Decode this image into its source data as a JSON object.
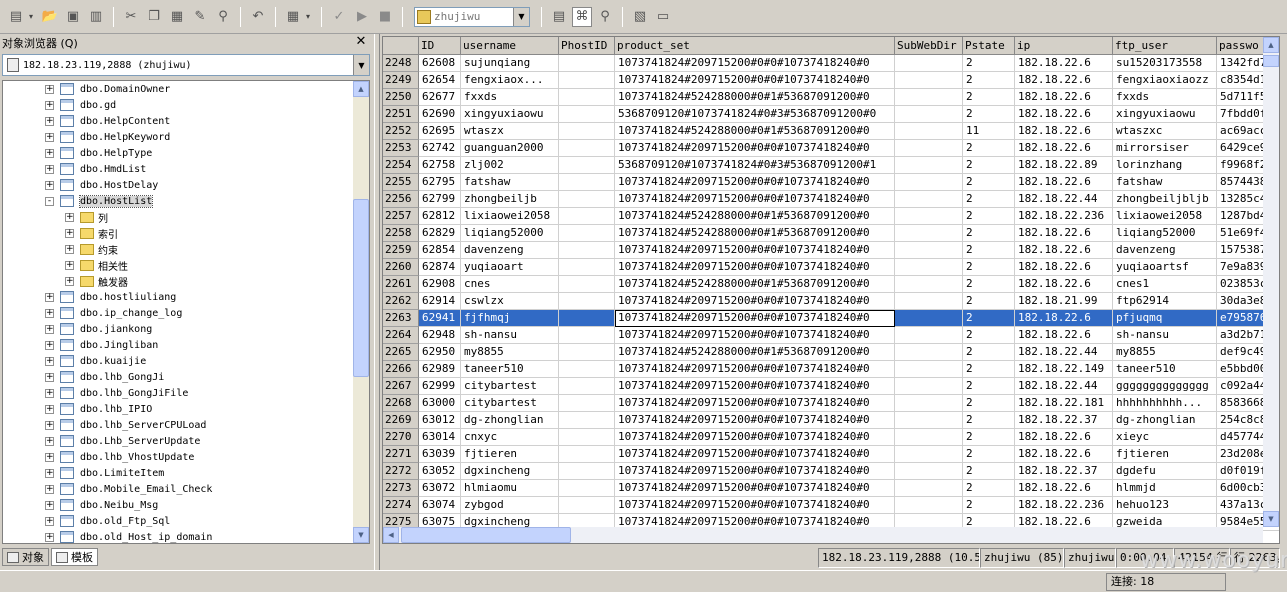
{
  "toolbar": {
    "db_value": "zhujiwu",
    "icons": [
      "new-query-icon",
      "open-icon",
      "save-icon",
      "save-all-icon",
      "cut-icon",
      "copy-icon",
      "paste-icon",
      "edit-icon",
      "find-icon",
      "undo-icon",
      "grid-icon",
      "check-icon",
      "execute-icon",
      "stop-icon",
      "database-icon",
      "results-pane-icon",
      "object-browser-icon",
      "object-search-icon",
      "properties-icon",
      "show-results-icon"
    ]
  },
  "left_pane": {
    "title": "对象浏览器 (Q)",
    "server": "182.18.23.119,2888 (zhujiwu)",
    "tree": [
      {
        "label": "dbo.DomainOwner",
        "type": "table",
        "level": 0,
        "exp": "+"
      },
      {
        "label": "dbo.gd",
        "type": "table",
        "level": 0,
        "exp": "+"
      },
      {
        "label": "dbo.HelpContent",
        "type": "table",
        "level": 0,
        "exp": "+"
      },
      {
        "label": "dbo.HelpKeyword",
        "type": "table",
        "level": 0,
        "exp": "+"
      },
      {
        "label": "dbo.HelpType",
        "type": "table",
        "level": 0,
        "exp": "+"
      },
      {
        "label": "dbo.HmdList",
        "type": "table",
        "level": 0,
        "exp": "+"
      },
      {
        "label": "dbo.HostDelay",
        "type": "table",
        "level": 0,
        "exp": "+"
      },
      {
        "label": "dbo.HostList",
        "type": "table",
        "level": 0,
        "exp": "-",
        "selected": true
      },
      {
        "label": "列",
        "type": "folder",
        "level": 1,
        "exp": "+"
      },
      {
        "label": "索引",
        "type": "folder",
        "level": 1,
        "exp": "+"
      },
      {
        "label": "约束",
        "type": "folder",
        "level": 1,
        "exp": "+"
      },
      {
        "label": "相关性",
        "type": "folder",
        "level": 1,
        "exp": "+"
      },
      {
        "label": "触发器",
        "type": "folder",
        "level": 1,
        "exp": "+"
      },
      {
        "label": "dbo.hostliuliang",
        "type": "table",
        "level": 0,
        "exp": "+"
      },
      {
        "label": "dbo.ip_change_log",
        "type": "table",
        "level": 0,
        "exp": "+"
      },
      {
        "label": "dbo.jiankong",
        "type": "table",
        "level": 0,
        "exp": "+"
      },
      {
        "label": "dbo.Jingliban",
        "type": "table",
        "level": 0,
        "exp": "+"
      },
      {
        "label": "dbo.kuaijie",
        "type": "table",
        "level": 0,
        "exp": "+"
      },
      {
        "label": "dbo.lhb_GongJi",
        "type": "table",
        "level": 0,
        "exp": "+"
      },
      {
        "label": "dbo.lhb_GongJiFile",
        "type": "table",
        "level": 0,
        "exp": "+"
      },
      {
        "label": "dbo.lhb_IPIO",
        "type": "table",
        "level": 0,
        "exp": "+"
      },
      {
        "label": "dbo.lhb_ServerCPULoad",
        "type": "table",
        "level": 0,
        "exp": "+"
      },
      {
        "label": "dbo.Lhb_ServerUpdate",
        "type": "table",
        "level": 0,
        "exp": "+"
      },
      {
        "label": "dbo.lhb_VhostUpdate",
        "type": "table",
        "level": 0,
        "exp": "+"
      },
      {
        "label": "dbo.LimiteItem",
        "type": "table",
        "level": 0,
        "exp": "+"
      },
      {
        "label": "dbo.Mobile_Email_Check",
        "type": "table",
        "level": 0,
        "exp": "+"
      },
      {
        "label": "dbo.Neibu_Msg",
        "type": "table",
        "level": 0,
        "exp": "+"
      },
      {
        "label": "dbo.old_Ftp_Sql",
        "type": "table",
        "level": 0,
        "exp": "+"
      },
      {
        "label": "dbo.old_Host_ip_domain",
        "type": "table",
        "level": 0,
        "exp": "+"
      }
    ],
    "tabs": [
      {
        "label": "对象",
        "icon": "object-tab-icon",
        "active": false
      },
      {
        "label": "模板",
        "icon": "template-tab-icon",
        "active": true
      }
    ]
  },
  "grid": {
    "columns": [
      "ID",
      "username",
      "PhostID",
      "product_set",
      "SubWebDir",
      "Pstate",
      "ip",
      "ftp_user",
      "passwo"
    ],
    "rows": [
      [
        "2248",
        "62608",
        "sujunqiang",
        "",
        "1073741824#209715200#0#0#10737418240#0",
        "",
        "2",
        "182.18.22.6",
        "su15203173558",
        "1342fd7"
      ],
      [
        "2249",
        "62654",
        "fengxiaox...",
        "",
        "1073741824#209715200#0#0#10737418240#0",
        "",
        "2",
        "182.18.22.6",
        "fengxiaoxiaozz",
        "c8354d1"
      ],
      [
        "2250",
        "62677",
        "fxxds",
        "",
        "1073741824#524288000#0#1#53687091200#0",
        "",
        "2",
        "182.18.22.6",
        "fxxds",
        "5d711f5"
      ],
      [
        "2251",
        "62690",
        "xingyuxiaowu",
        "",
        "5368709120#1073741824#0#3#53687091200#0",
        "",
        "2",
        "182.18.22.6",
        "xingyuxiaowu",
        "7fbdd0f"
      ],
      [
        "2252",
        "62695",
        "wtaszx",
        "",
        "1073741824#524288000#0#1#53687091200#0",
        "",
        "11",
        "182.18.22.6",
        "wtaszxc",
        "ac69acc"
      ],
      [
        "2253",
        "62742",
        "guanguan2000",
        "",
        "1073741824#209715200#0#0#10737418240#0",
        "",
        "2",
        "182.18.22.6",
        "mirrorsiser",
        "6429ce9"
      ],
      [
        "2254",
        "62758",
        "zlj002",
        "",
        "5368709120#1073741824#0#3#53687091200#1",
        "",
        "2",
        "182.18.22.89",
        "lorinzhang",
        "f9968f2"
      ],
      [
        "2255",
        "62795",
        "fatshaw",
        "",
        "1073741824#209715200#0#0#10737418240#0",
        "",
        "2",
        "182.18.22.6",
        "fatshaw",
        "8574438"
      ],
      [
        "2256",
        "62799",
        "zhongbeiljb",
        "",
        "1073741824#209715200#0#0#10737418240#0",
        "",
        "2",
        "182.18.22.44",
        "zhongbeiljbljb",
        "13285c4"
      ],
      [
        "2257",
        "62812",
        "lixiaowei2058",
        "",
        "1073741824#524288000#0#1#53687091200#0",
        "",
        "2",
        "182.18.22.236",
        "lixiaowei2058",
        "1287bd4"
      ],
      [
        "2258",
        "62829",
        "liqiang52000",
        "",
        "1073741824#524288000#0#1#53687091200#0",
        "",
        "2",
        "182.18.22.6",
        "liqiang52000",
        "51e69f4"
      ],
      [
        "2259",
        "62854",
        "davenzeng",
        "",
        "1073741824#209715200#0#0#10737418240#0",
        "",
        "2",
        "182.18.22.6",
        "davenzeng",
        "1575387"
      ],
      [
        "2260",
        "62874",
        "yuqiaoart",
        "",
        "1073741824#209715200#0#0#10737418240#0",
        "",
        "2",
        "182.18.22.6",
        "yuqiaoartsf",
        "7e9a839"
      ],
      [
        "2261",
        "62908",
        "cnes",
        "",
        "1073741824#524288000#0#1#53687091200#0",
        "",
        "2",
        "182.18.22.6",
        "cnes1",
        "023853c"
      ],
      [
        "2262",
        "62914",
        "cswlzx",
        "",
        "1073741824#209715200#0#0#10737418240#0",
        "",
        "2",
        "182.18.21.99",
        "ftp62914",
        "30da3e8"
      ],
      [
        "2263",
        "62941",
        "fjfhmqj",
        "",
        "1073741824#209715200#0#0#10737418240#0",
        "",
        "2",
        "182.18.22.6",
        "pfjuqmq",
        "e795876"
      ],
      [
        "2264",
        "62948",
        "sh-nansu",
        "",
        "1073741824#209715200#0#0#10737418240#0",
        "",
        "2",
        "182.18.22.6",
        "sh-nansu",
        "a3d2b71"
      ],
      [
        "2265",
        "62950",
        "my8855",
        "",
        "1073741824#524288000#0#1#53687091200#0",
        "",
        "2",
        "182.18.22.44",
        "my8855",
        "def9c49"
      ],
      [
        "2266",
        "62989",
        "taneer510",
        "",
        "1073741824#209715200#0#0#10737418240#0",
        "",
        "2",
        "182.18.22.149",
        "taneer510",
        "e5bbd00"
      ],
      [
        "2267",
        "62999",
        "citybartest",
        "",
        "1073741824#209715200#0#0#10737418240#0",
        "",
        "2",
        "182.18.22.44",
        "gggggggggggggg",
        "c092a44"
      ],
      [
        "2268",
        "63000",
        "citybartest",
        "",
        "1073741824#209715200#0#0#10737418240#0",
        "",
        "2",
        "182.18.22.181",
        "hhhhhhhhhh...",
        "8583668"
      ],
      [
        "2269",
        "63012",
        "dg-zhonglian",
        "",
        "1073741824#209715200#0#0#10737418240#0",
        "",
        "2",
        "182.18.22.37",
        "dg-zhonglian",
        "254c8c8"
      ],
      [
        "2270",
        "63014",
        "cnxyc",
        "",
        "1073741824#209715200#0#0#10737418240#0",
        "",
        "2",
        "182.18.22.6",
        "xieyc",
        "d457744"
      ],
      [
        "2271",
        "63039",
        "fjtieren",
        "",
        "1073741824#209715200#0#0#10737418240#0",
        "",
        "2",
        "182.18.22.6",
        "fjtieren",
        "23d208e"
      ],
      [
        "2272",
        "63052",
        "dgxincheng",
        "",
        "1073741824#209715200#0#0#10737418240#0",
        "",
        "2",
        "182.18.22.37",
        "dgdefu",
        "d0f019f"
      ],
      [
        "2273",
        "63072",
        "hlmiaomu",
        "",
        "1073741824#209715200#0#0#10737418240#0",
        "",
        "2",
        "182.18.22.6",
        "hlmmjd",
        "6d00cb3"
      ],
      [
        "2274",
        "63074",
        "zybgod",
        "",
        "1073741824#209715200#0#0#10737418240#0",
        "",
        "2",
        "182.18.22.236",
        "hehuo123",
        "437a13c"
      ],
      [
        "2275",
        "63075",
        "dgxincheng",
        "",
        "1073741824#209715200#0#0#10737418240#0",
        "",
        "2",
        "182.18.22.6",
        "gzweida",
        "9584e55"
      ]
    ],
    "selected_row": 15
  },
  "status": {
    "server": "182.18.23.119,2888 (10.50)",
    "user": "zhujiwu (85)",
    "db": "zhujiwu",
    "time": "0:00:04",
    "rows": "42154 行",
    "position": "行 2263，列 4",
    "connections": "连接: 18"
  },
  "watermark": "www.wooyun.org"
}
